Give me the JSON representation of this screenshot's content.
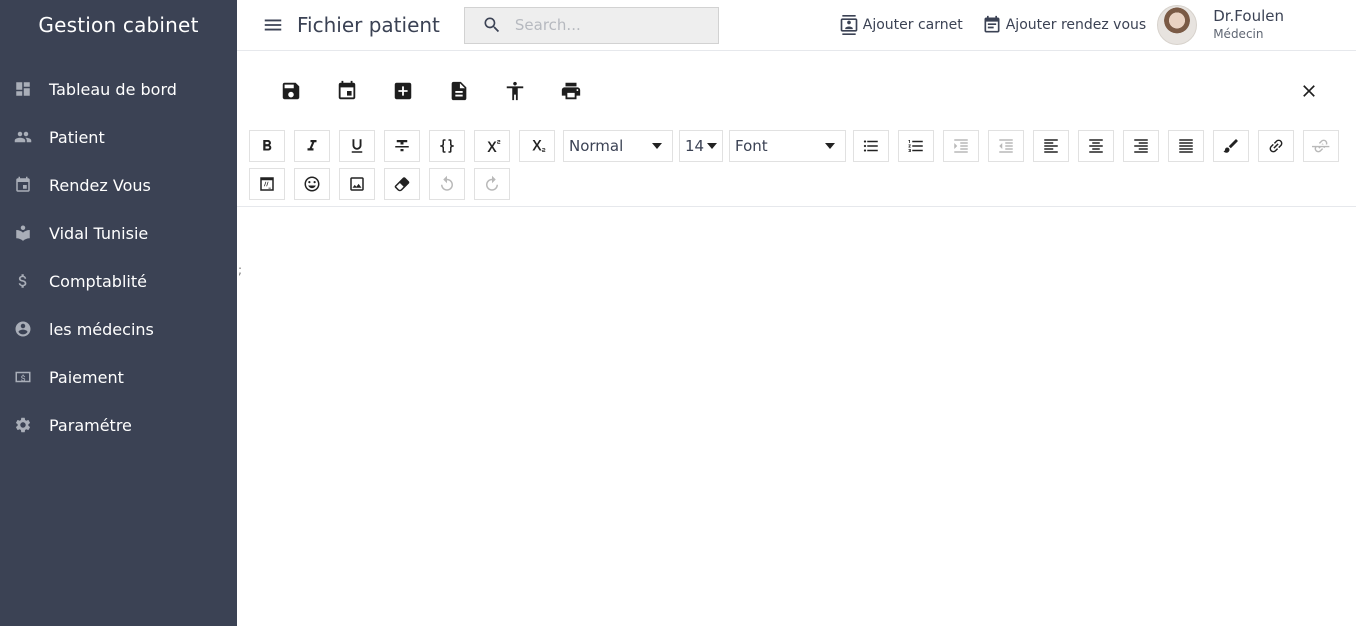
{
  "sidebar": {
    "brand": "Gestion cabinet",
    "items": [
      {
        "label": "Tableau de bord",
        "icon": "dashboard-icon"
      },
      {
        "label": "Patient",
        "icon": "people-icon"
      },
      {
        "label": "Rendez Vous",
        "icon": "calendar-icon"
      },
      {
        "label": "Vidal Tunisie",
        "icon": "book-icon"
      },
      {
        "label": "Comptablité",
        "icon": "dollar-icon"
      },
      {
        "label": "les médecins",
        "icon": "account-circle-icon"
      },
      {
        "label": "Paiement",
        "icon": "payment-icon"
      },
      {
        "label": "Paramétre",
        "icon": "gear-icon"
      }
    ]
  },
  "header": {
    "title": "Fichier patient",
    "search_placeholder": "Search...",
    "actions": [
      {
        "label": "Ajouter carnet",
        "icon": "contact-card-icon"
      },
      {
        "label": "Ajouter rendez vous",
        "icon": "event-note-icon"
      }
    ],
    "user": {
      "name": "Dr.Foulen",
      "role": "Médecin"
    }
  },
  "actions_toolbar": [
    "save-icon",
    "calendar-icon",
    "add-box-icon",
    "document-icon",
    "accessibility-icon",
    "print-icon",
    "close-icon"
  ],
  "editor": {
    "header_select": "Normal",
    "size_select": "14",
    "font_select": "Font",
    "content": ";"
  },
  "colors": {
    "sidebar_bg": "#3b4254",
    "sidebar_icon": "#a9aeb8",
    "text": "#3b4254"
  }
}
